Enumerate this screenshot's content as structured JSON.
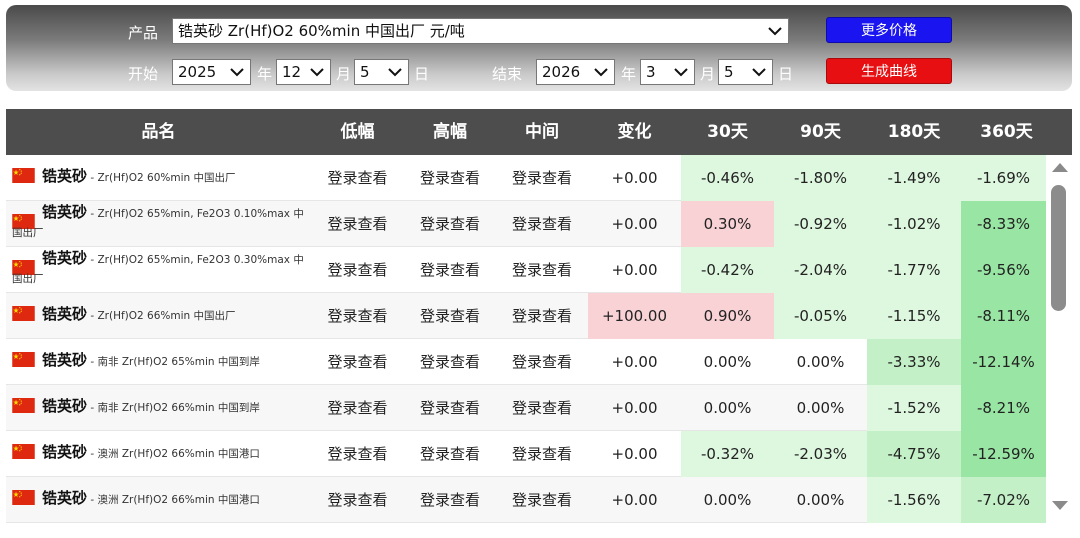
{
  "filters": {
    "product_label": "产品",
    "product_value": "锆英砂 Zr(Hf)O2 60%min 中国出厂 元/吨",
    "start_label": "开始",
    "end_label": "结束",
    "start": {
      "year": "2025",
      "month": "12",
      "day": "5"
    },
    "end": {
      "year": "2026",
      "month": "3",
      "day": "5"
    },
    "year_unit": "年",
    "month_unit": "月",
    "day_unit": "日",
    "more_prices_label": "更多价格",
    "generate_chart_label": "生成曲线"
  },
  "colors": {
    "more_prices_button": "#1a14f0",
    "generate_chart_button": "#e80f12",
    "header_bg": "#4d4d4d",
    "up_light": "#f9d2d6",
    "down_light": "#def7df",
    "down_mid": "#c3f0c7",
    "down_strong": "#99e6a4"
  },
  "table": {
    "headers": [
      "品名",
      "低幅",
      "高幅",
      "中间",
      "变化",
      "30天",
      "90天",
      "180天",
      "360天"
    ],
    "login_text": "登录查看",
    "rows": [
      {
        "name": "锆英砂",
        "desc": "Zr(Hf)O2 60%min 中国出厂",
        "desc_wrap": "",
        "change": "+0.00",
        "d30": "-0.46%",
        "d90": "-1.80%",
        "d180": "-1.49%",
        "d360": "-1.69%"
      },
      {
        "name": "锆英砂",
        "desc": "Zr(Hf)O2 65%min, Fe2O3 0.10%max 中",
        "desc_wrap": "国出厂",
        "change": "+0.00",
        "d30": "0.30%",
        "d90": "-0.92%",
        "d180": "-1.02%",
        "d360": "-8.33%"
      },
      {
        "name": "锆英砂",
        "desc": "Zr(Hf)O2 65%min, Fe2O3 0.30%max 中",
        "desc_wrap": "国出厂",
        "change": "+0.00",
        "d30": "-0.42%",
        "d90": "-2.04%",
        "d180": "-1.77%",
        "d360": "-9.56%"
      },
      {
        "name": "锆英砂",
        "desc": "Zr(Hf)O2 66%min 中国出厂",
        "desc_wrap": "",
        "change": "+100.00",
        "d30": "0.90%",
        "d90": "-0.05%",
        "d180": "-1.15%",
        "d360": "-8.11%"
      },
      {
        "name": "锆英砂",
        "desc": "南非 Zr(Hf)O2 65%min 中国到岸",
        "desc_wrap": "",
        "change": "+0.00",
        "d30": "0.00%",
        "d90": "0.00%",
        "d180": "-3.33%",
        "d360": "-12.14%"
      },
      {
        "name": "锆英砂",
        "desc": "南非 Zr(Hf)O2 66%min 中国到岸",
        "desc_wrap": "",
        "change": "+0.00",
        "d30": "0.00%",
        "d90": "0.00%",
        "d180": "-1.52%",
        "d360": "-8.21%"
      },
      {
        "name": "锆英砂",
        "desc": "澳洲 Zr(Hf)O2 66%min 中国港口",
        "desc_wrap": "",
        "change": "+0.00",
        "d30": "-0.32%",
        "d90": "-2.03%",
        "d180": "-4.75%",
        "d360": "-12.59%"
      },
      {
        "name": "锆英砂",
        "desc": "澳洲 Zr(Hf)O2 66%min 中国港口",
        "desc_wrap": "",
        "change": "+0.00",
        "d30": "0.00%",
        "d90": "0.00%",
        "d180": "-1.56%",
        "d360": "-7.02%"
      }
    ]
  }
}
